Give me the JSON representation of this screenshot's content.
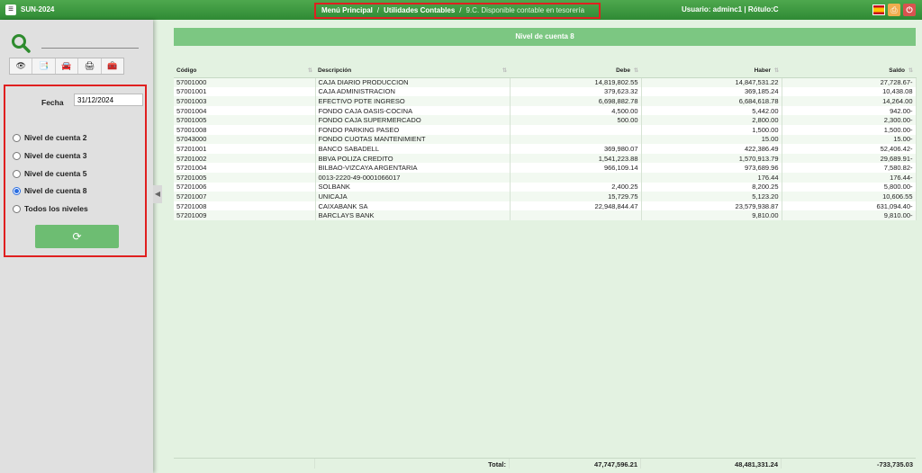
{
  "header": {
    "app_name": "SUN-2024",
    "breadcrumb": [
      "Menú Principal",
      "Utilidades Contables",
      "9.C. Disponible contable en tesorería"
    ],
    "breadcrumb_sep": "/",
    "user_label": "Usuario: adminc1 | Rótulo:C"
  },
  "sidebar": {
    "fecha_label": "Fecha",
    "fecha_value": "31/12/2024",
    "options": [
      {
        "label": "Nivel de cuenta 2",
        "selected": false
      },
      {
        "label": "Nivel de cuenta 3",
        "selected": false
      },
      {
        "label": "Nivel de cuenta 5",
        "selected": false
      },
      {
        "label": "Nivel de cuenta 8",
        "selected": true
      },
      {
        "label": "Todos los niveles",
        "selected": false
      }
    ],
    "icons": [
      "eye-icon",
      "documents-icon",
      "car-icon",
      "printer-icon",
      "toolbox-icon"
    ]
  },
  "main": {
    "title": "Nivel de cuenta 8",
    "columns": [
      "Código",
      "Descripción",
      "Debe",
      "Haber",
      "Saldo"
    ],
    "rows": [
      [
        "57001000",
        "CAJA DIARIO PRODUCCION",
        "14,819,802.55",
        "14,847,531.22",
        "27,728.67-"
      ],
      [
        "57001001",
        "CAJA ADMINISTRACION",
        "379,623.32",
        "369,185.24",
        "10,438.08"
      ],
      [
        "57001003",
        "EFECTIVO PDTE INGRESO",
        "6,698,882.78",
        "6,684,618.78",
        "14,264.00"
      ],
      [
        "57001004",
        "FONDO CAJA OASIS-COCINA",
        "4,500.00",
        "5,442.00",
        "942.00-"
      ],
      [
        "57001005",
        "FONDO CAJA SUPERMERCADO",
        "500.00",
        "2,800.00",
        "2,300.00-"
      ],
      [
        "57001008",
        "FONDO PARKING PASEO",
        "",
        "1,500.00",
        "1,500.00-"
      ],
      [
        "57043000",
        "FONDO CUOTAS MANTENIMIENT",
        "",
        "15.00",
        "15.00-"
      ],
      [
        "57201001",
        "BANCO SABADELL",
        "369,980.07",
        "422,386.49",
        "52,406.42-"
      ],
      [
        "57201002",
        "BBVA POLIZA CREDITO",
        "1,541,223.88",
        "1,570,913.79",
        "29,689.91-"
      ],
      [
        "57201004",
        "BILBAO-VIZCAYA ARGENTARIA",
        "966,109.14",
        "973,689.96",
        "7,580.82-"
      ],
      [
        "57201005",
        "0013-2220-49-0001066017",
        "",
        "176.44",
        "176.44-"
      ],
      [
        "57201006",
        "SOLBANK",
        "2,400.25",
        "8,200.25",
        "5,800.00-"
      ],
      [
        "57201007",
        "UNICAJA",
        "15,729.75",
        "5,123.20",
        "10,606.55"
      ],
      [
        "57201008",
        "CAIXABANK SA",
        "22,948,844.47",
        "23,579,938.87",
        "631,094.40-"
      ],
      [
        "57201009",
        "BARCLAYS BANK",
        "",
        "9,810.00",
        "9,810.00-"
      ]
    ],
    "totals": {
      "label": "Total:",
      "debe": "47,747,596.21",
      "haber": "48,481,331.24",
      "saldo": "-733,735.03"
    }
  }
}
